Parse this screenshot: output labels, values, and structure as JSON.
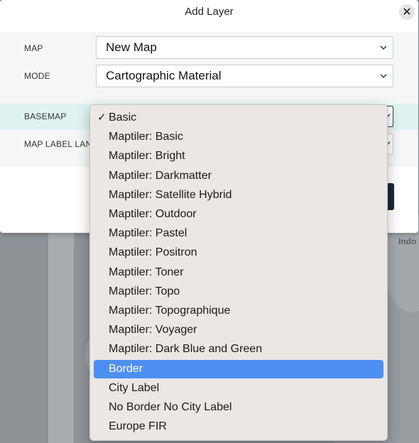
{
  "dialog": {
    "title": "Add Layer",
    "close_label": "✕"
  },
  "fields": {
    "map": {
      "label": "MAP",
      "value": "New Map"
    },
    "mode": {
      "label": "MODE",
      "value": "Cartographic Material"
    },
    "basemap": {
      "label": "BASEMAP"
    },
    "map_label_language": {
      "label": "MAP LABEL LAN"
    }
  },
  "icons": {
    "chevron": "chevron-down-icon",
    "check": "checkmark-icon",
    "close": "close-icon"
  },
  "basemap_menu": {
    "selected": "Basic",
    "highlighted": "Border",
    "highlight_color": "#4c8ff0",
    "check_glyph": "✓",
    "items": [
      "Basic",
      "Maptiler: Basic",
      "Maptiler: Bright",
      "Maptiler: Darkmatter",
      "Maptiler: Satellite Hybrid",
      "Maptiler: Outdoor",
      "Maptiler: Pastel",
      "Maptiler: Positron",
      "Maptiler: Toner",
      "Maptiler: Topo",
      "Maptiler: Topographique",
      "Maptiler: Voyager",
      "Maptiler: Dark Blue and Green",
      "Border",
      "City Label",
      "No Border No City Label",
      "Europe FIR"
    ]
  },
  "map_bg": {
    "label_right": "Indo"
  }
}
